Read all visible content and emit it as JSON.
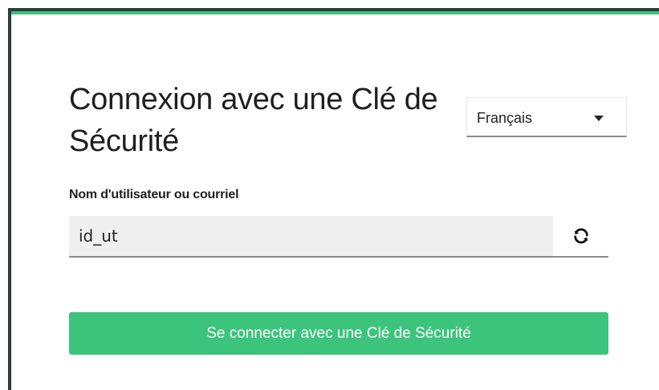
{
  "login": {
    "title": "Connexion avec une Clé de Sécurité",
    "language": {
      "selected": "Français"
    },
    "username": {
      "label": "Nom d'utilisateur ou courriel",
      "value": "id_ut"
    },
    "submit_label": "Se connecter avec une Clé de Sécurité",
    "icons": {
      "refresh": "refresh-icon",
      "dropdown": "caret-down-icon"
    }
  },
  "colors": {
    "accent": "#3cc47c",
    "frame": "#2e3b3a",
    "input_bg": "#efefef",
    "text": "#1f1f1f"
  }
}
